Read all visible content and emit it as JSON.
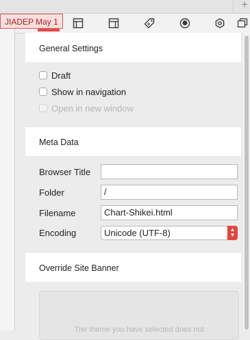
{
  "tag": {
    "label": "JIADEP May 1"
  },
  "toolbar": {
    "icons": [
      "page-icon",
      "layout-icon",
      "layout-alt-icon",
      "tag-icon",
      "badge-icon",
      "gear-icon",
      "window-icon"
    ]
  },
  "general_settings": {
    "title": "General Settings",
    "draft_label": "Draft",
    "show_nav_label": "Show in navigation",
    "open_new_window_label": "Open in new window"
  },
  "meta_data": {
    "title": "Meta Data",
    "browser_title_label": "Browser Title",
    "browser_title_value": "",
    "folder_label": "Folder",
    "folder_value": "/",
    "filename_label": "Filename",
    "filename_value": "Chart-Shikei.html",
    "encoding_label": "Encoding",
    "encoding_value": "Unicode (UTF-8)"
  },
  "override_banner": {
    "title": "Override Site Banner",
    "message": "The theme you have selected does not"
  },
  "colors": {
    "accent": "#e0453e",
    "tag_border": "#d85a5a",
    "tag_bg": "#f9dede"
  }
}
